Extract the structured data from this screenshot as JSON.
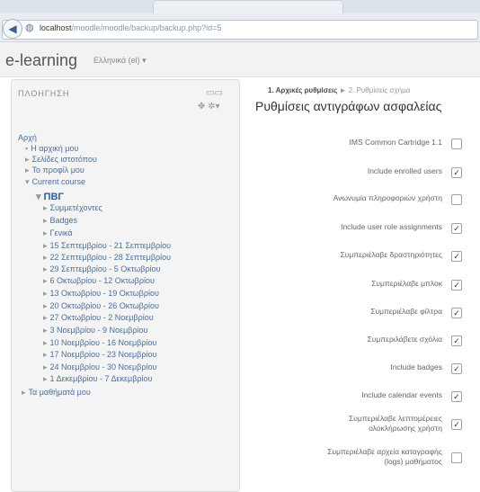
{
  "browser": {
    "host": "localhost",
    "path": "/moodle/moodle/backup/backup.php?id=5"
  },
  "header": {
    "brand": "e-learning",
    "language": "Ελληνικά (el) ▾"
  },
  "nav": {
    "title": "ΠΛΟΗΓΗΣΗ",
    "items": [
      {
        "label": "Αρχή",
        "arrow": ""
      },
      {
        "label": "Η αρχική μου",
        "arrow": "▪"
      },
      {
        "label": "Σελίδες ιστοτόπου",
        "arrow": "▸"
      },
      {
        "label": "Το προφίλ μου",
        "arrow": "▸"
      },
      {
        "label": "Current course",
        "arrow": "▾"
      },
      {
        "label": "ΠΒΓ",
        "arrow": "▾"
      },
      {
        "label": "Συμμετέχοντες",
        "arrow": "▸"
      },
      {
        "label": "Badges",
        "arrow": "▸"
      },
      {
        "label": "Γενικά",
        "arrow": "▸"
      },
      {
        "label": "15 Σεπτεμβρίου - 21 Σεπτεμβρίου",
        "arrow": "▸"
      },
      {
        "label": "22 Σεπτεμβρίου - 28 Σεπτεμβρίου",
        "arrow": "▸"
      },
      {
        "label": "29 Σεπτεμβρίου - 5 Οκτωβρίου",
        "arrow": "▸"
      },
      {
        "label": "6 Οκτωβρίου - 12 Οκτωβρίου",
        "arrow": "▸"
      },
      {
        "label": "13 Οκτωβρίου - 19 Οκτωβρίου",
        "arrow": "▸"
      },
      {
        "label": "20 Οκτωβρίου - 26 Οκτωβρίου",
        "arrow": "▸"
      },
      {
        "label": "27 Οκτωβρίου - 2 Νοεμβρίου",
        "arrow": "▸"
      },
      {
        "label": "3 Νοεμβρίου - 9 Νοεμβρίου",
        "arrow": "▸"
      },
      {
        "label": "10 Νοεμβρίου - 16 Νοεμβρίου",
        "arrow": "▸"
      },
      {
        "label": "17 Νοεμβρίου - 23 Νοεμβρίου",
        "arrow": "▸"
      },
      {
        "label": "24 Νοεμβρίου - 30 Νοεμβρίου",
        "arrow": "▸"
      },
      {
        "label": "1 Δεκεμβρίου - 7 Δεκεμβρίου",
        "arrow": "▸"
      },
      {
        "label": "Τα μαθήματά μου",
        "arrow": "▸"
      }
    ]
  },
  "breadcrumb": {
    "current": "1. Αρχικές ρυθμίσεις",
    "separator": "►",
    "next": "2. Ρυθμίσεις σχήμα"
  },
  "page_title": "Ρυθμίσεις αντιγράφων ασφαλείας",
  "settings": [
    {
      "label": "IMS Common Cartridge 1.1",
      "checked": false
    },
    {
      "label": "Include enrolled users",
      "checked": true
    },
    {
      "label": "Ανωνυμία πληροφοριών χρήστη",
      "checked": false
    },
    {
      "label": "Include user role assignments",
      "checked": true
    },
    {
      "label": "Συμπεριέλαβε δραστηριότητες",
      "checked": true
    },
    {
      "label": "Συμπεριέλαβε μπλοκ",
      "checked": true
    },
    {
      "label": "Συμπεριέλαβε φίλτρα",
      "checked": true
    },
    {
      "label": "Συμπεριλάβετε σχόλια",
      "checked": true
    },
    {
      "label": "Include badges",
      "checked": true
    },
    {
      "label": "Include calendar events",
      "checked": true
    },
    {
      "label": "Συμπεριέλαβε λεπτομέρειες ολοκλήρωσης χρήστη",
      "checked": true
    },
    {
      "label": "Συμπεριέλαβε αρχεία καταγραφής (logs) μαθήματος",
      "checked": false
    }
  ]
}
